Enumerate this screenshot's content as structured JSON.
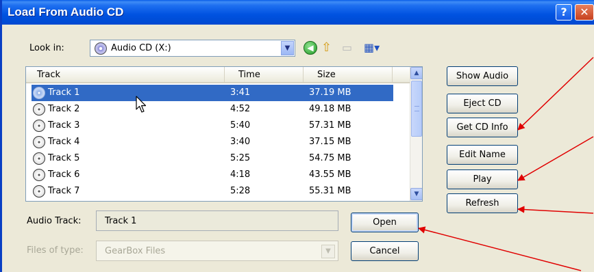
{
  "window": {
    "title": "Load From Audio CD"
  },
  "titlebar": {
    "help": "?",
    "close": "✕"
  },
  "lookin": {
    "label": "Look in:",
    "value": "Audio CD (X:)"
  },
  "columns": {
    "track": "Track",
    "time": "Time",
    "size": "Size"
  },
  "tracks": [
    {
      "name": "Track 1",
      "time": "3:41",
      "size": "37.19 MB"
    },
    {
      "name": "Track 2",
      "time": "4:52",
      "size": "49.18 MB"
    },
    {
      "name": "Track 3",
      "time": "5:40",
      "size": "57.31 MB"
    },
    {
      "name": "Track 4",
      "time": "3:40",
      "size": "37.15 MB"
    },
    {
      "name": "Track 5",
      "time": "5:25",
      "size": "54.75 MB"
    },
    {
      "name": "Track 6",
      "time": "4:18",
      "size": "43.55 MB"
    },
    {
      "name": "Track 7",
      "time": "5:28",
      "size": "55.31 MB"
    }
  ],
  "selected_index": 0,
  "audio_track": {
    "label": "Audio Track:",
    "value": "Track 1"
  },
  "files_of_type": {
    "label": "Files of type:",
    "value": "GearBox Files"
  },
  "buttons": {
    "open": "Open",
    "cancel": "Cancel",
    "show_audio": "Show Audio",
    "eject_cd": "Eject CD",
    "get_cd_info": "Get CD Info",
    "edit_name": "Edit Name",
    "play": "Play",
    "refresh": "Refresh"
  },
  "colors": {
    "titlebar": "#0052e0",
    "selection": "#316ac5",
    "annotation_arrow": "#e00000"
  }
}
